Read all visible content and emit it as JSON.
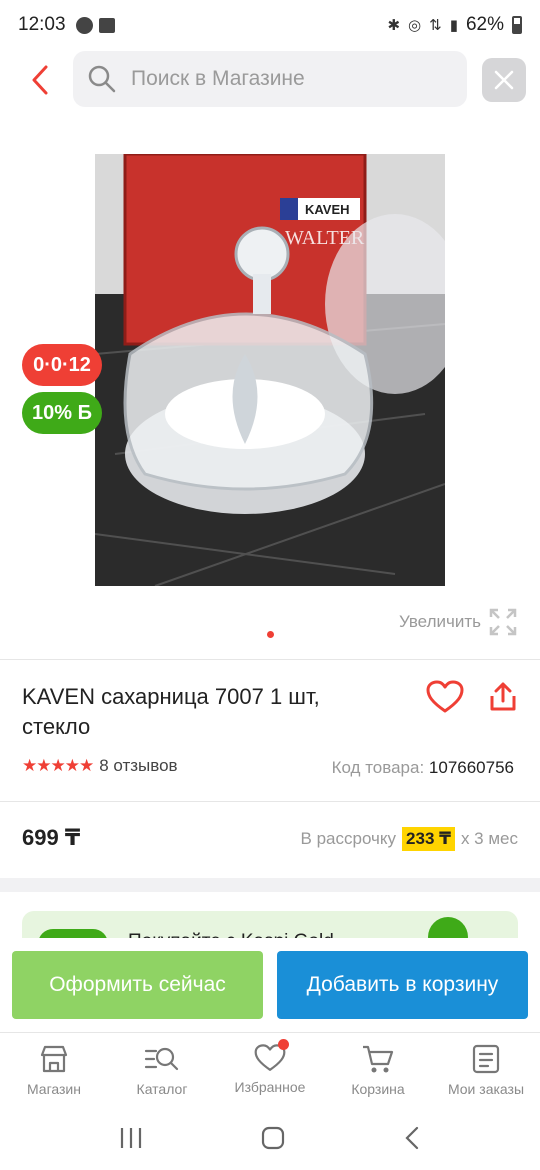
{
  "status_bar": {
    "time": "12:03",
    "battery": "62%"
  },
  "header": {
    "search_placeholder": "Поиск в Магазине"
  },
  "product": {
    "badge_installment": "0·0·12",
    "badge_bonus": "10% Б",
    "zoom_label": "Увеличить",
    "title": "KAVEN сахарница 7007 1 шт, стекло",
    "reviews": "8 отзывов",
    "rating": 5,
    "sku_label": "Код товара:",
    "sku_value": "107660756",
    "price": "699 ₸",
    "installment_prefix": "В рассрочку",
    "installment_amount": "233 ₸",
    "installment_suffix": "х 3 мес",
    "image_box_brand": "KAVEH",
    "image_box_line": "WALTER"
  },
  "promo": {
    "text": "Покупайте с Kaspi Gold"
  },
  "actions": {
    "buy_now": "Оформить сейчас",
    "add_to_cart": "Добавить в корзину"
  },
  "nav": {
    "items": [
      {
        "label": "Магазин",
        "icon": "store-icon"
      },
      {
        "label": "Каталог",
        "icon": "catalog-search-icon"
      },
      {
        "label": "Избранное",
        "icon": "heart-icon"
      },
      {
        "label": "Корзина",
        "icon": "cart-icon"
      },
      {
        "label": "Мои заказы",
        "icon": "orders-icon"
      }
    ]
  },
  "colors": {
    "accent_red": "#ef3f35",
    "green": "#3faa18",
    "buy_green": "#8fd364",
    "cart_blue": "#1a8fd7",
    "installment_yellow": "#ffd400"
  }
}
